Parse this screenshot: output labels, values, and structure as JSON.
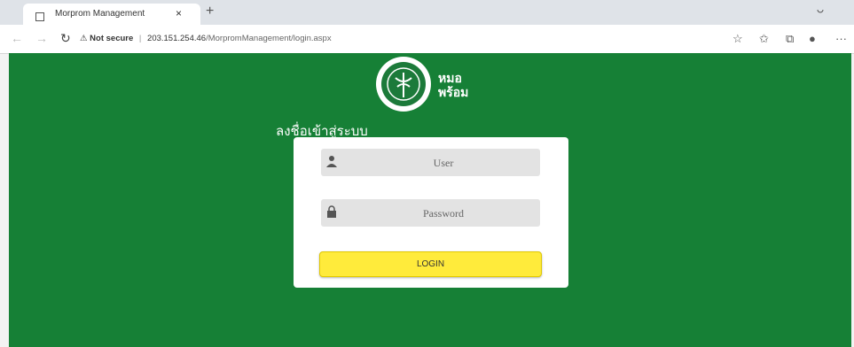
{
  "browser": {
    "tab_title": "Morprom Management",
    "tab_close": "×",
    "new_tab": "+",
    "url_warning": "Not secure",
    "url_separator": "|",
    "url_host": "203.151.254.46",
    "url_path": "/MorpromManagement/login.aspx",
    "more": "···"
  },
  "logo": {
    "line1": "หมอ",
    "line2": "พร้อม"
  },
  "page": {
    "title": "ลงชื่อเข้าสู่ระบบ"
  },
  "form": {
    "user_placeholder": "User",
    "password_placeholder": "Password",
    "login_label": "LOGIN"
  },
  "colors": {
    "page_bg": "#168036",
    "button_bg": "#ffeb3b",
    "field_bg": "#e3e3e3"
  }
}
